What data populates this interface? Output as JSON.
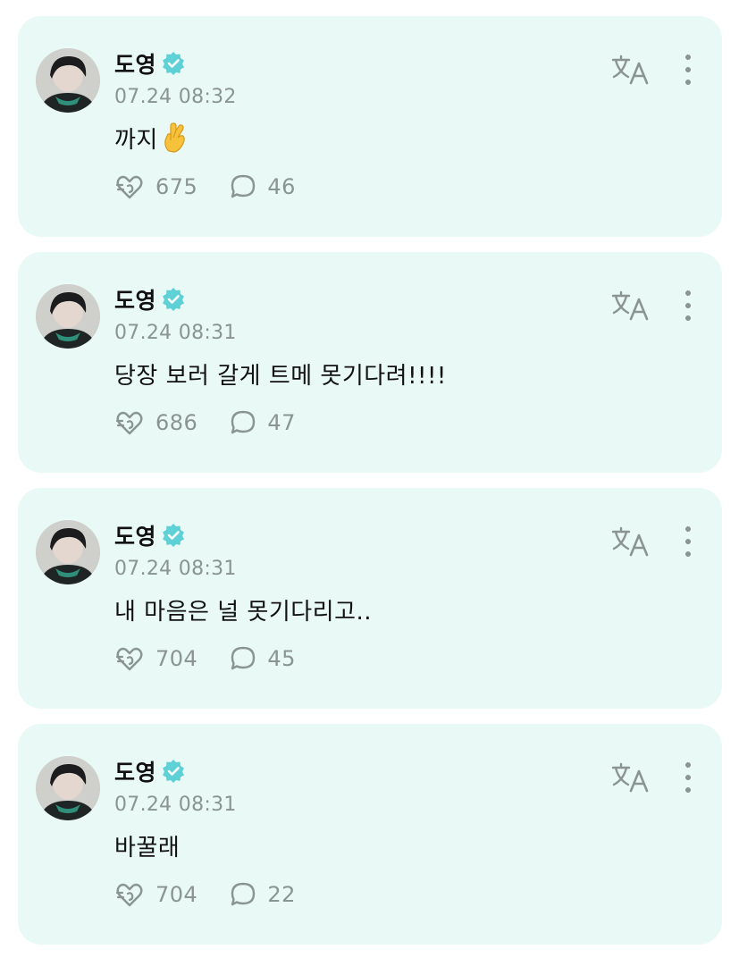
{
  "colors": {
    "card_background": "#e9f9f6",
    "verified_badge": "#5fd0d6",
    "meta_text": "#8a9490",
    "body_text": "#111111"
  },
  "posts": [
    {
      "author": "도영",
      "verified": true,
      "timestamp": "07.24 08:32",
      "text": "까지",
      "emoji": "crossed-fingers",
      "likes": "675",
      "comments": "46"
    },
    {
      "author": "도영",
      "verified": true,
      "timestamp": "07.24 08:31",
      "text": "당장 보러 갈게 트메 못기다려!!!!",
      "likes": "686",
      "comments": "47"
    },
    {
      "author": "도영",
      "verified": true,
      "timestamp": "07.24 08:31",
      "text": "내 마음은 널 못기다리고..",
      "likes": "704",
      "comments": "45"
    },
    {
      "author": "도영",
      "verified": true,
      "timestamp": "07.24 08:31",
      "text": "바꿀래",
      "likes": "704",
      "comments": "22"
    }
  ],
  "icons": {
    "like": "heart-reaction-icon",
    "comment": "comment-bubble-icon",
    "translate": "translate-icon",
    "more": "more-vertical-icon",
    "verified": "verified-badge-icon"
  }
}
